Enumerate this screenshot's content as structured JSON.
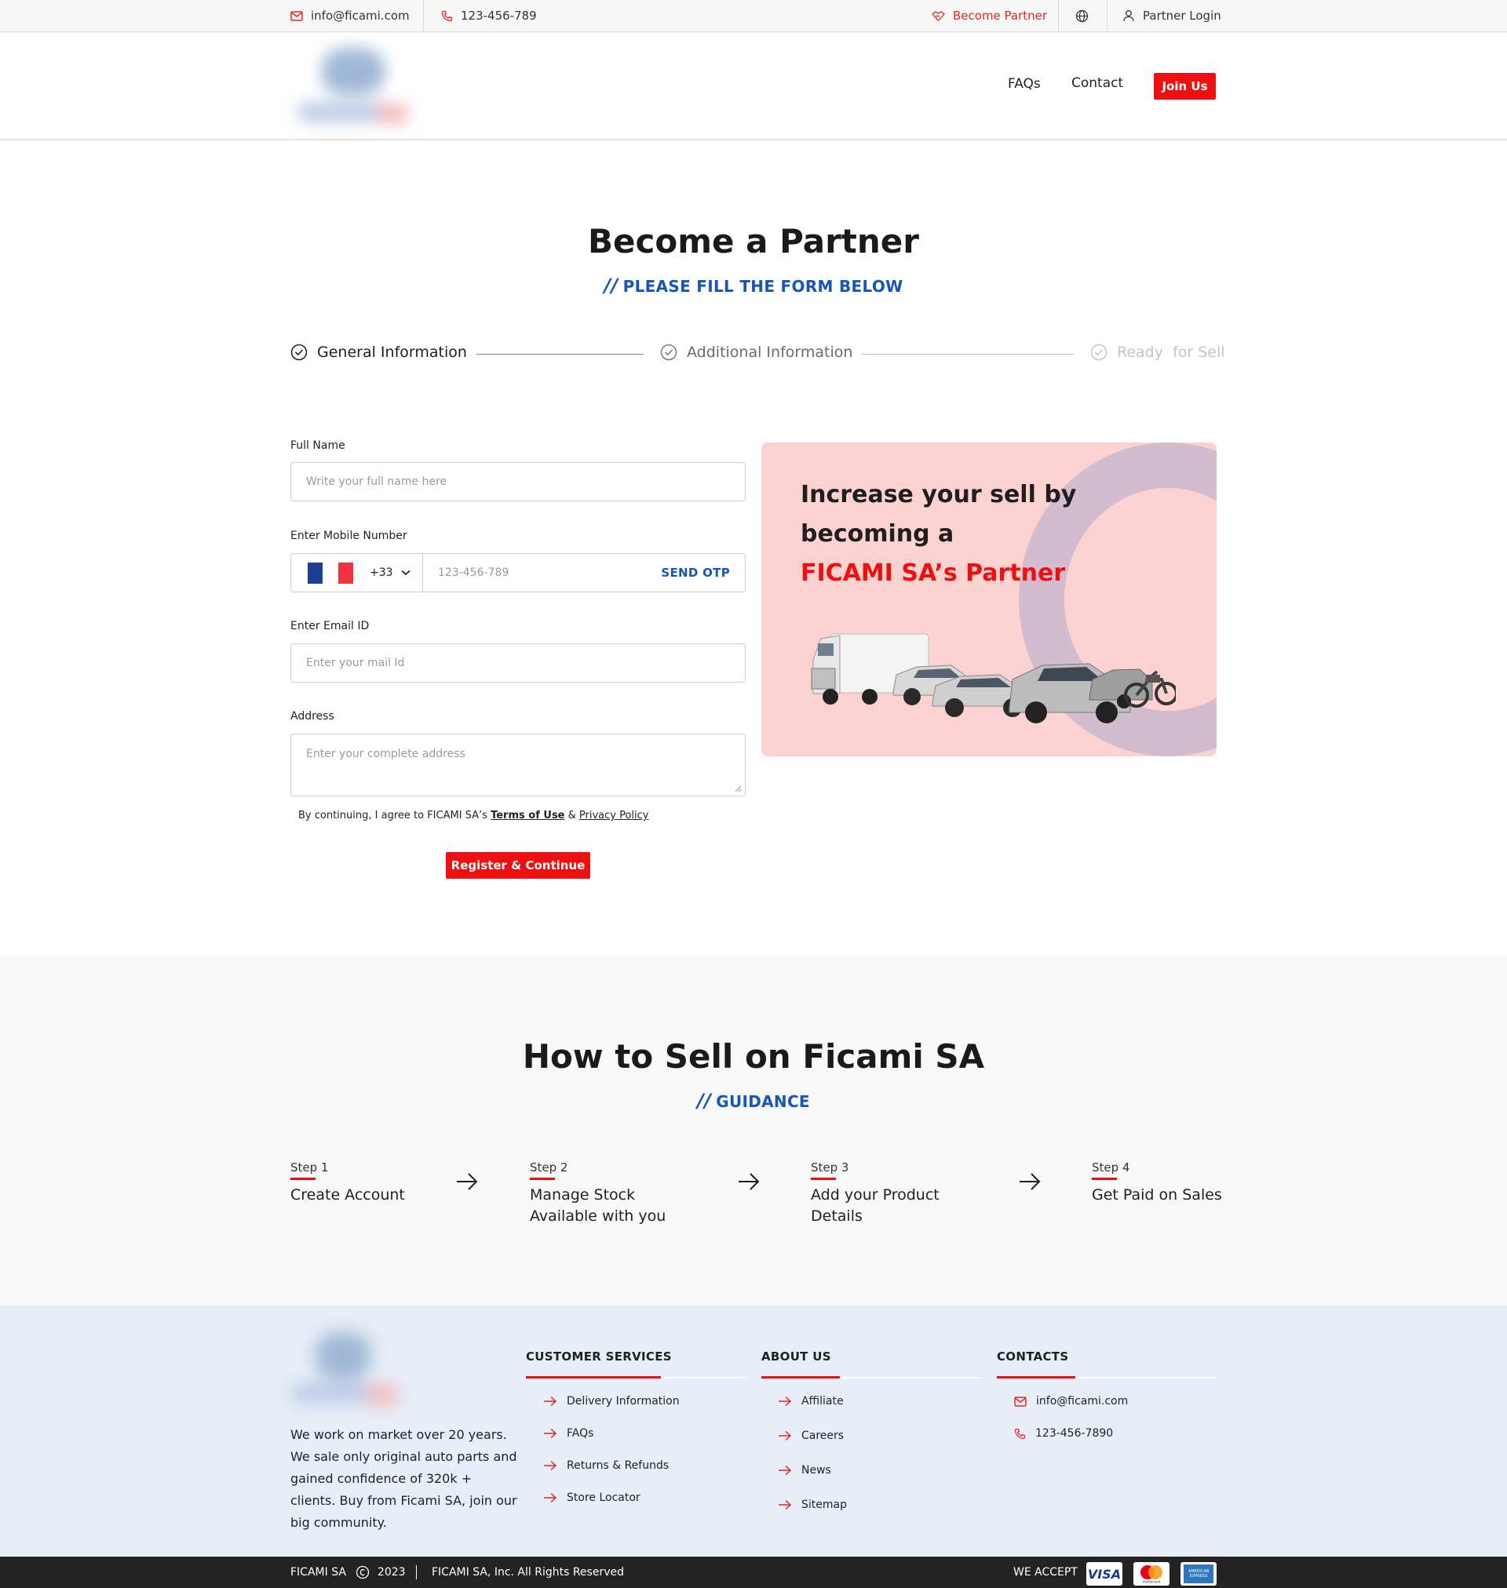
{
  "topbar": {
    "email": "info@ficami.com",
    "phone": "123-456-789",
    "become_partner": "Become Partner",
    "partner_login": "Partner Login"
  },
  "header": {
    "nav": {
      "faqs": "FAQs",
      "contact": "Contact",
      "join": "Join Us"
    }
  },
  "hero": {
    "title": "Become a Partner",
    "slashes": "//",
    "subtitle": "PLEASE FILL THE FORM BELOW"
  },
  "progress": {
    "steps": [
      {
        "label": "General Information",
        "state": "active"
      },
      {
        "label": "Additional Information",
        "state": "pending"
      },
      {
        "label": "Ready  for Sell",
        "state": "disabled"
      }
    ]
  },
  "form": {
    "full_name": {
      "label": "Full Name",
      "placeholder": "Write your full name here"
    },
    "mobile": {
      "label": "Enter Mobile Number",
      "country_code": "+33",
      "placeholder": "123-456-789",
      "otp": "SEND OTP"
    },
    "email": {
      "label": "Enter Email ID",
      "placeholder": "Enter your mail Id"
    },
    "address": {
      "label": "Address",
      "placeholder": "Enter your complete address"
    },
    "agree_prefix": "By continuing, I agree to FICAMI SA’s ",
    "terms": "Terms of Use",
    "amp": " & ",
    "privacy": "Privacy Policy",
    "submit": "Register & Continue"
  },
  "promo": {
    "line1": "Increase your sell by",
    "line2": "becoming a",
    "line3": "FICAMI SA’s Partner"
  },
  "how": {
    "title": "How to Sell on Ficami SA",
    "slashes": "//",
    "subtitle": "GUIDANCE",
    "steps": [
      {
        "step": "Step 1",
        "line1": "Create Account",
        "line2": ""
      },
      {
        "step": "Step 2",
        "line1": "Manage Stock",
        "line2": "Available with you"
      },
      {
        "step": "Step 3",
        "line1": "Add your Product",
        "line2": "Details"
      },
      {
        "step": "Step 4",
        "line1": "Get Paid on Sales",
        "line2": ""
      }
    ]
  },
  "footer": {
    "about": "We work on market over 20 years. We sale only original auto parts and gained confidence of 320k + clients. Buy from Ficami SA, join our big community.",
    "customer_services": {
      "title": "CUSTOMER SERVICES",
      "links": [
        "Delivery Information",
        "FAQs",
        "Returns & Refunds",
        "Store Locator"
      ]
    },
    "about_us": {
      "title": "ABOUT US",
      "links": [
        "Affiliate",
        "Careers",
        "News",
        "Sitemap"
      ]
    },
    "contacts": {
      "title": "CONTACTS",
      "email": "info@ficami.com",
      "phone": "123-456-7890"
    }
  },
  "bottombar": {
    "brand": "FICAMI SA",
    "year": "2023",
    "rights": "FICAMI SA, Inc. All Rights Reserved",
    "we_accept": "WE ACCEPT",
    "visa": "VISA",
    "mastercard_text": "mastercard",
    "amex_text": "AMERICAN EXPRESS"
  },
  "colors": {
    "accent_red": "#ee1010",
    "accent_blue": "#1556b8",
    "promo_bg": "#fcd2d0",
    "footer_bg": "#e7eef7"
  }
}
